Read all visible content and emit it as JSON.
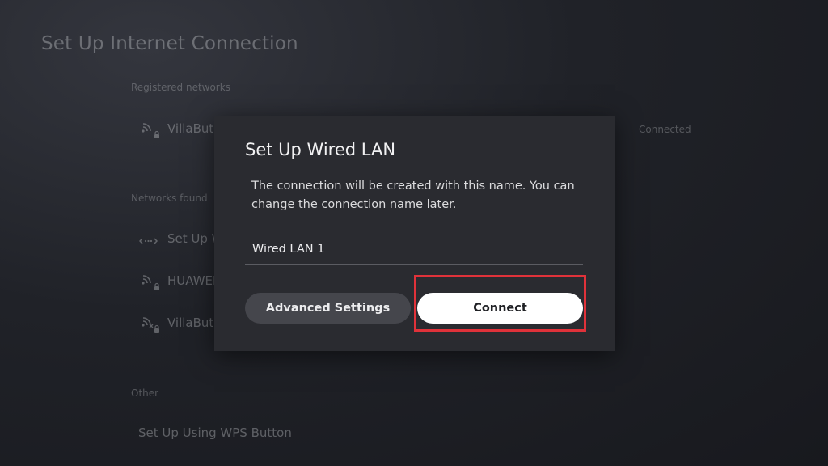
{
  "page": {
    "title": "Set Up Internet Connection"
  },
  "registered_networks": {
    "label": "Registered networks",
    "items": [
      {
        "name": "VillaButl",
        "status": "Connected",
        "icon": "wifi-locked-icon"
      }
    ]
  },
  "networks_found": {
    "label": "Networks found",
    "items": [
      {
        "name": "Set Up W",
        "icon": "wired-lan-icon"
      },
      {
        "name": "HUAWEI",
        "icon": "wifi-locked-icon"
      },
      {
        "name": "VillaButl",
        "icon": "wifi-disconnected-locked-icon"
      }
    ]
  },
  "other": {
    "label": "Other",
    "items": [
      {
        "name": "Set Up Using WPS Button"
      }
    ]
  },
  "dialog": {
    "title": "Set Up Wired LAN",
    "description": "The connection will be created with this name. You can change the connection name later.",
    "connection_name_value": "Wired LAN 1",
    "advanced_button_label": "Advanced Settings",
    "connect_button_label": "Connect"
  },
  "colors": {
    "highlight": "#e0323a",
    "dialog_background": "#2a2b30",
    "primary_button": "#ffffff",
    "secondary_button": "#45464c"
  }
}
